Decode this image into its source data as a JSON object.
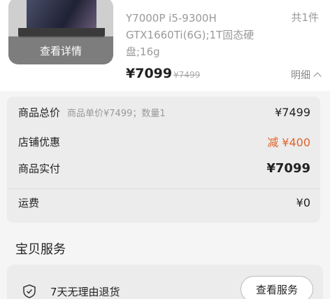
{
  "product": {
    "thumb_label": "查看详情",
    "spec": "Y7000P i5-9300H GTX1660Ti(6G);1T固态硬盘;16g",
    "quantity": "共1件",
    "price": "¥7099",
    "original_price": "¥7499",
    "detail_toggle": "明细"
  },
  "breakdown": {
    "total_label": "商品总价",
    "total_sub": "商品单价¥7499；数量1",
    "total_value": "¥7499",
    "discount_label": "店铺优惠",
    "discount_value": "减 ¥400",
    "actual_label": "商品实付",
    "actual_value": "¥7099",
    "shipping_label": "运费",
    "shipping_value": "¥0"
  },
  "services": {
    "title": "宝贝服务",
    "item_label": "7天无理由退货",
    "button_label": "查看服务"
  }
}
